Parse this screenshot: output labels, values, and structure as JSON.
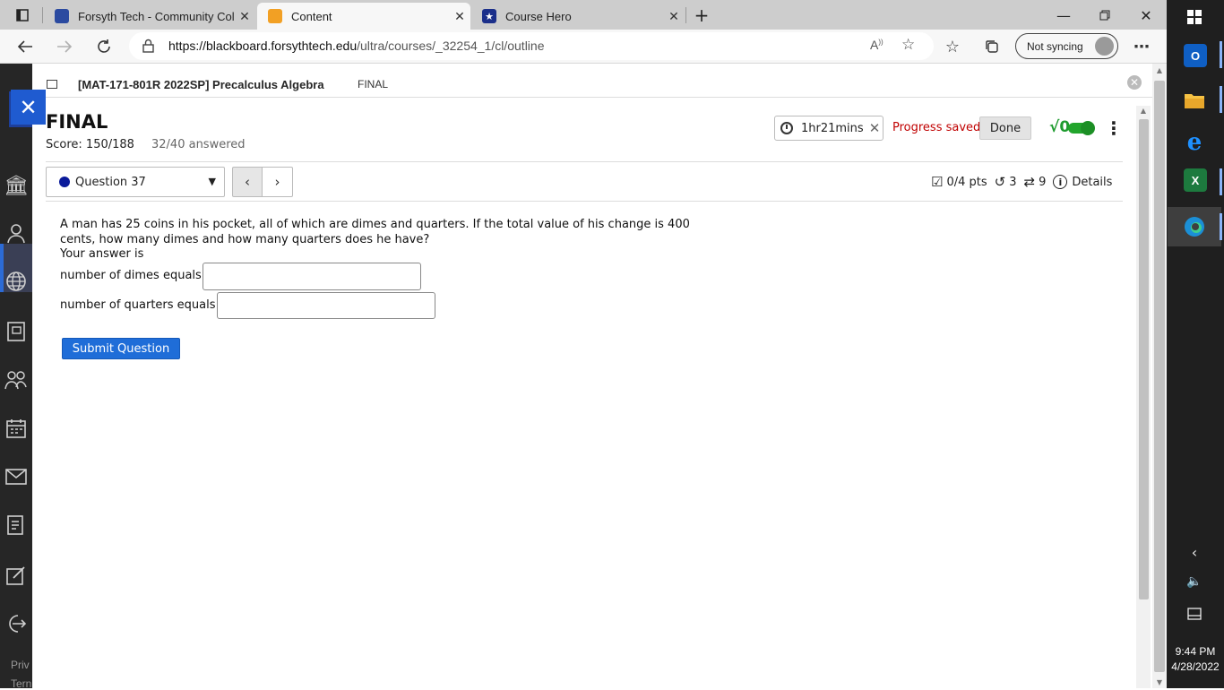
{
  "browser": {
    "tabs": [
      {
        "title": "Forsyth Tech - Community Colleg",
        "favicon_color": "#2b4aa0"
      },
      {
        "title": "Content",
        "favicon_color": "#f2a024"
      },
      {
        "title": "Course Hero",
        "favicon_color": "#1b2f8a"
      }
    ],
    "url_host": "https://blackboard.forsythtech.edu",
    "url_path": "/ultra/courses/_32254_1/cl/outline",
    "sync_label": "Not syncing"
  },
  "course": {
    "title": "[MAT-171-801R 2022SP] Precalculus Algebra",
    "breadcrumb": "FINAL"
  },
  "exam": {
    "title": "FINAL",
    "score": "Score: 150/188",
    "answered": "32/40 answered",
    "timer": "1hr21mins",
    "progress": "Progress saved",
    "done_label": "Done",
    "sqrt_label": "√0"
  },
  "question": {
    "selector_label": "Question 37",
    "points": "0/4 pts",
    "retries": "3",
    "attempts": "9",
    "details_label": "Details",
    "text": "A man has 25 coins in his pocket, all of which are dimes and quarters. If the total value of his change is 400 cents, how many dimes and how many quarters does he have?",
    "your_answer": "Your answer is",
    "dimes_label": "number of dimes equals",
    "dimes_value": "",
    "quarters_label": "number of quarters equals",
    "quarters_value": "",
    "submit_label": "Submit Question"
  },
  "leftnav": {
    "bottom_text_1": "Priv",
    "bottom_text_2": "Tern"
  },
  "taskbar": {
    "time": "9:44 PM",
    "date": "4/28/2022"
  }
}
